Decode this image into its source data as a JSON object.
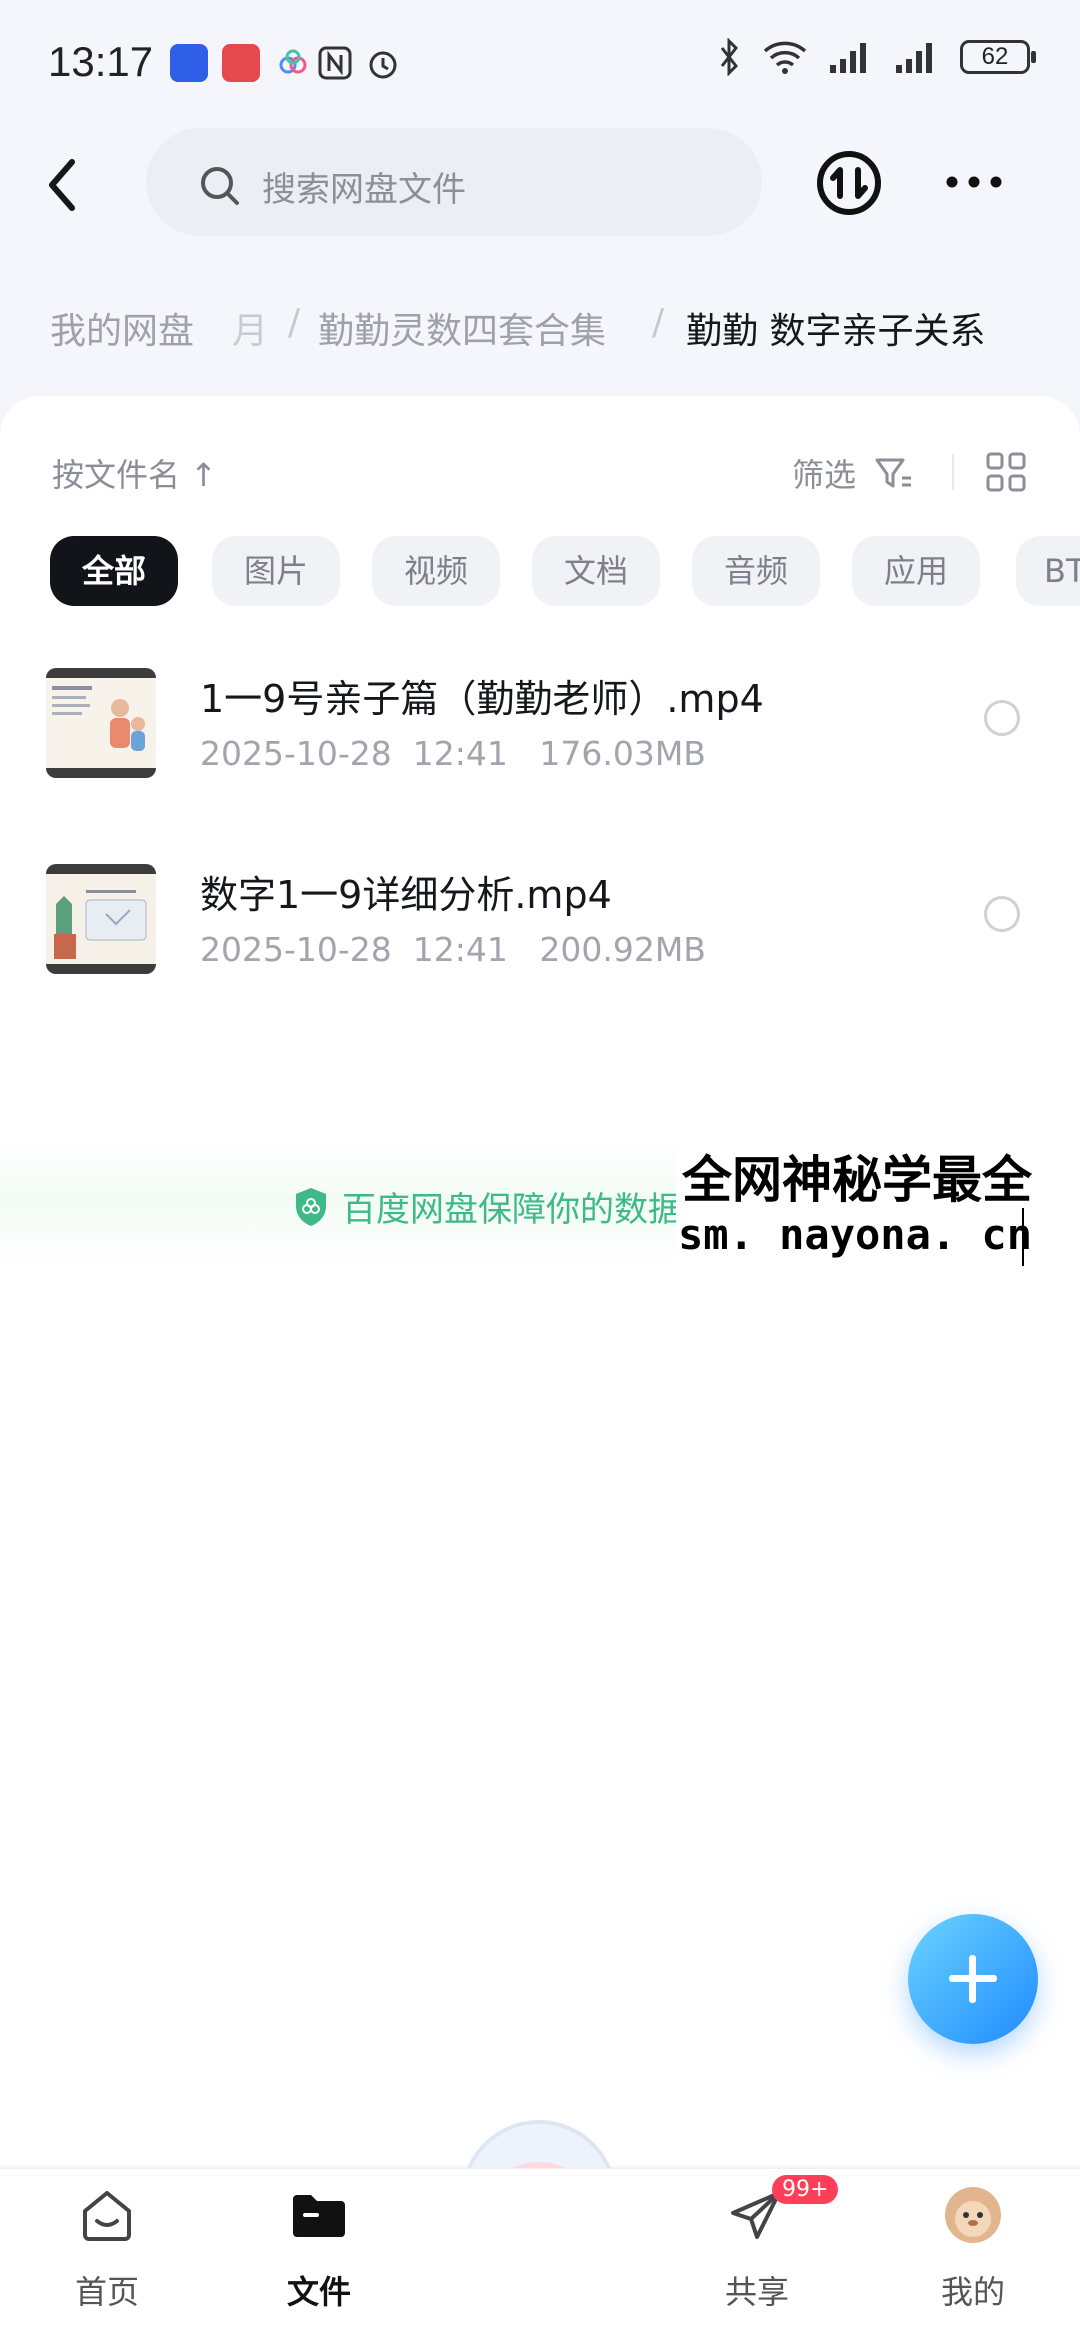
{
  "status_bar": {
    "time": "13:17",
    "battery": "62"
  },
  "search": {
    "placeholder": "搜索网盘文件"
  },
  "breadcrumb": {
    "root": "我的网盘",
    "partial": "月",
    "folder1": "勤勤灵数四套合集",
    "current": "勤勤  数字亲子关系"
  },
  "toolbar": {
    "sort_label": "按文件名 ↑",
    "filter_label": "筛选"
  },
  "chips": [
    "全部",
    "图片",
    "视频",
    "文档",
    "音频",
    "应用",
    "BT"
  ],
  "files": [
    {
      "name": "1一9号亲子篇（勤勤老师）.mp4",
      "date": "2025-10-28",
      "time": "12:41",
      "size": "176.03MB"
    },
    {
      "name": "数字1一9详细分析.mp4",
      "date": "2025-10-28",
      "time": "12:41",
      "size": "200.92MB"
    }
  ],
  "guard": {
    "text": "百度网盘保障你的数据"
  },
  "overlay": {
    "line1": "全网神秘学最全",
    "line2": "sm. nayona. cn"
  },
  "nav": {
    "home": "首页",
    "files": "文件",
    "share": "共享",
    "share_badge": "99+",
    "mine": "我的"
  },
  "colors": {
    "accent": "#1f8bff",
    "guard_green": "#3dba88",
    "badge_red": "#ff3f5a"
  }
}
